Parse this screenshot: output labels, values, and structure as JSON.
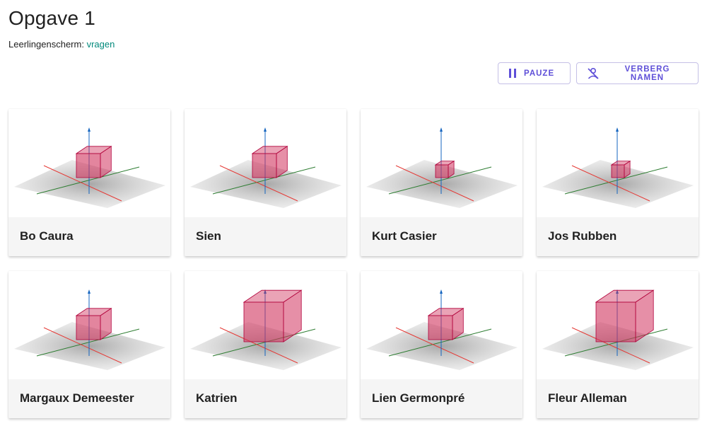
{
  "header": {
    "title": "Opgave 1",
    "screen_label": "Leerlingenscherm:",
    "screen_value": "vragen"
  },
  "toolbar": {
    "pause_label": "PAUZE",
    "hide_names_label": "VERBERG NAMEN"
  },
  "colors": {
    "accent": "#5e4fd8",
    "link": "#00897b",
    "cube_fill": "#d1335e",
    "plane": "#bdbdbd"
  },
  "students": [
    {
      "name": "Bo Caura",
      "cube_size": "medium"
    },
    {
      "name": "Sien",
      "cube_size": "medium"
    },
    {
      "name": "Kurt Casier",
      "cube_size": "small"
    },
    {
      "name": "Jos Rubben",
      "cube_size": "small"
    },
    {
      "name": "Margaux Demeester",
      "cube_size": "medium"
    },
    {
      "name": "Katrien",
      "cube_size": "large"
    },
    {
      "name": "Lien Germonpré",
      "cube_size": "medium"
    },
    {
      "name": "Fleur Alleman",
      "cube_size": "large"
    }
  ]
}
